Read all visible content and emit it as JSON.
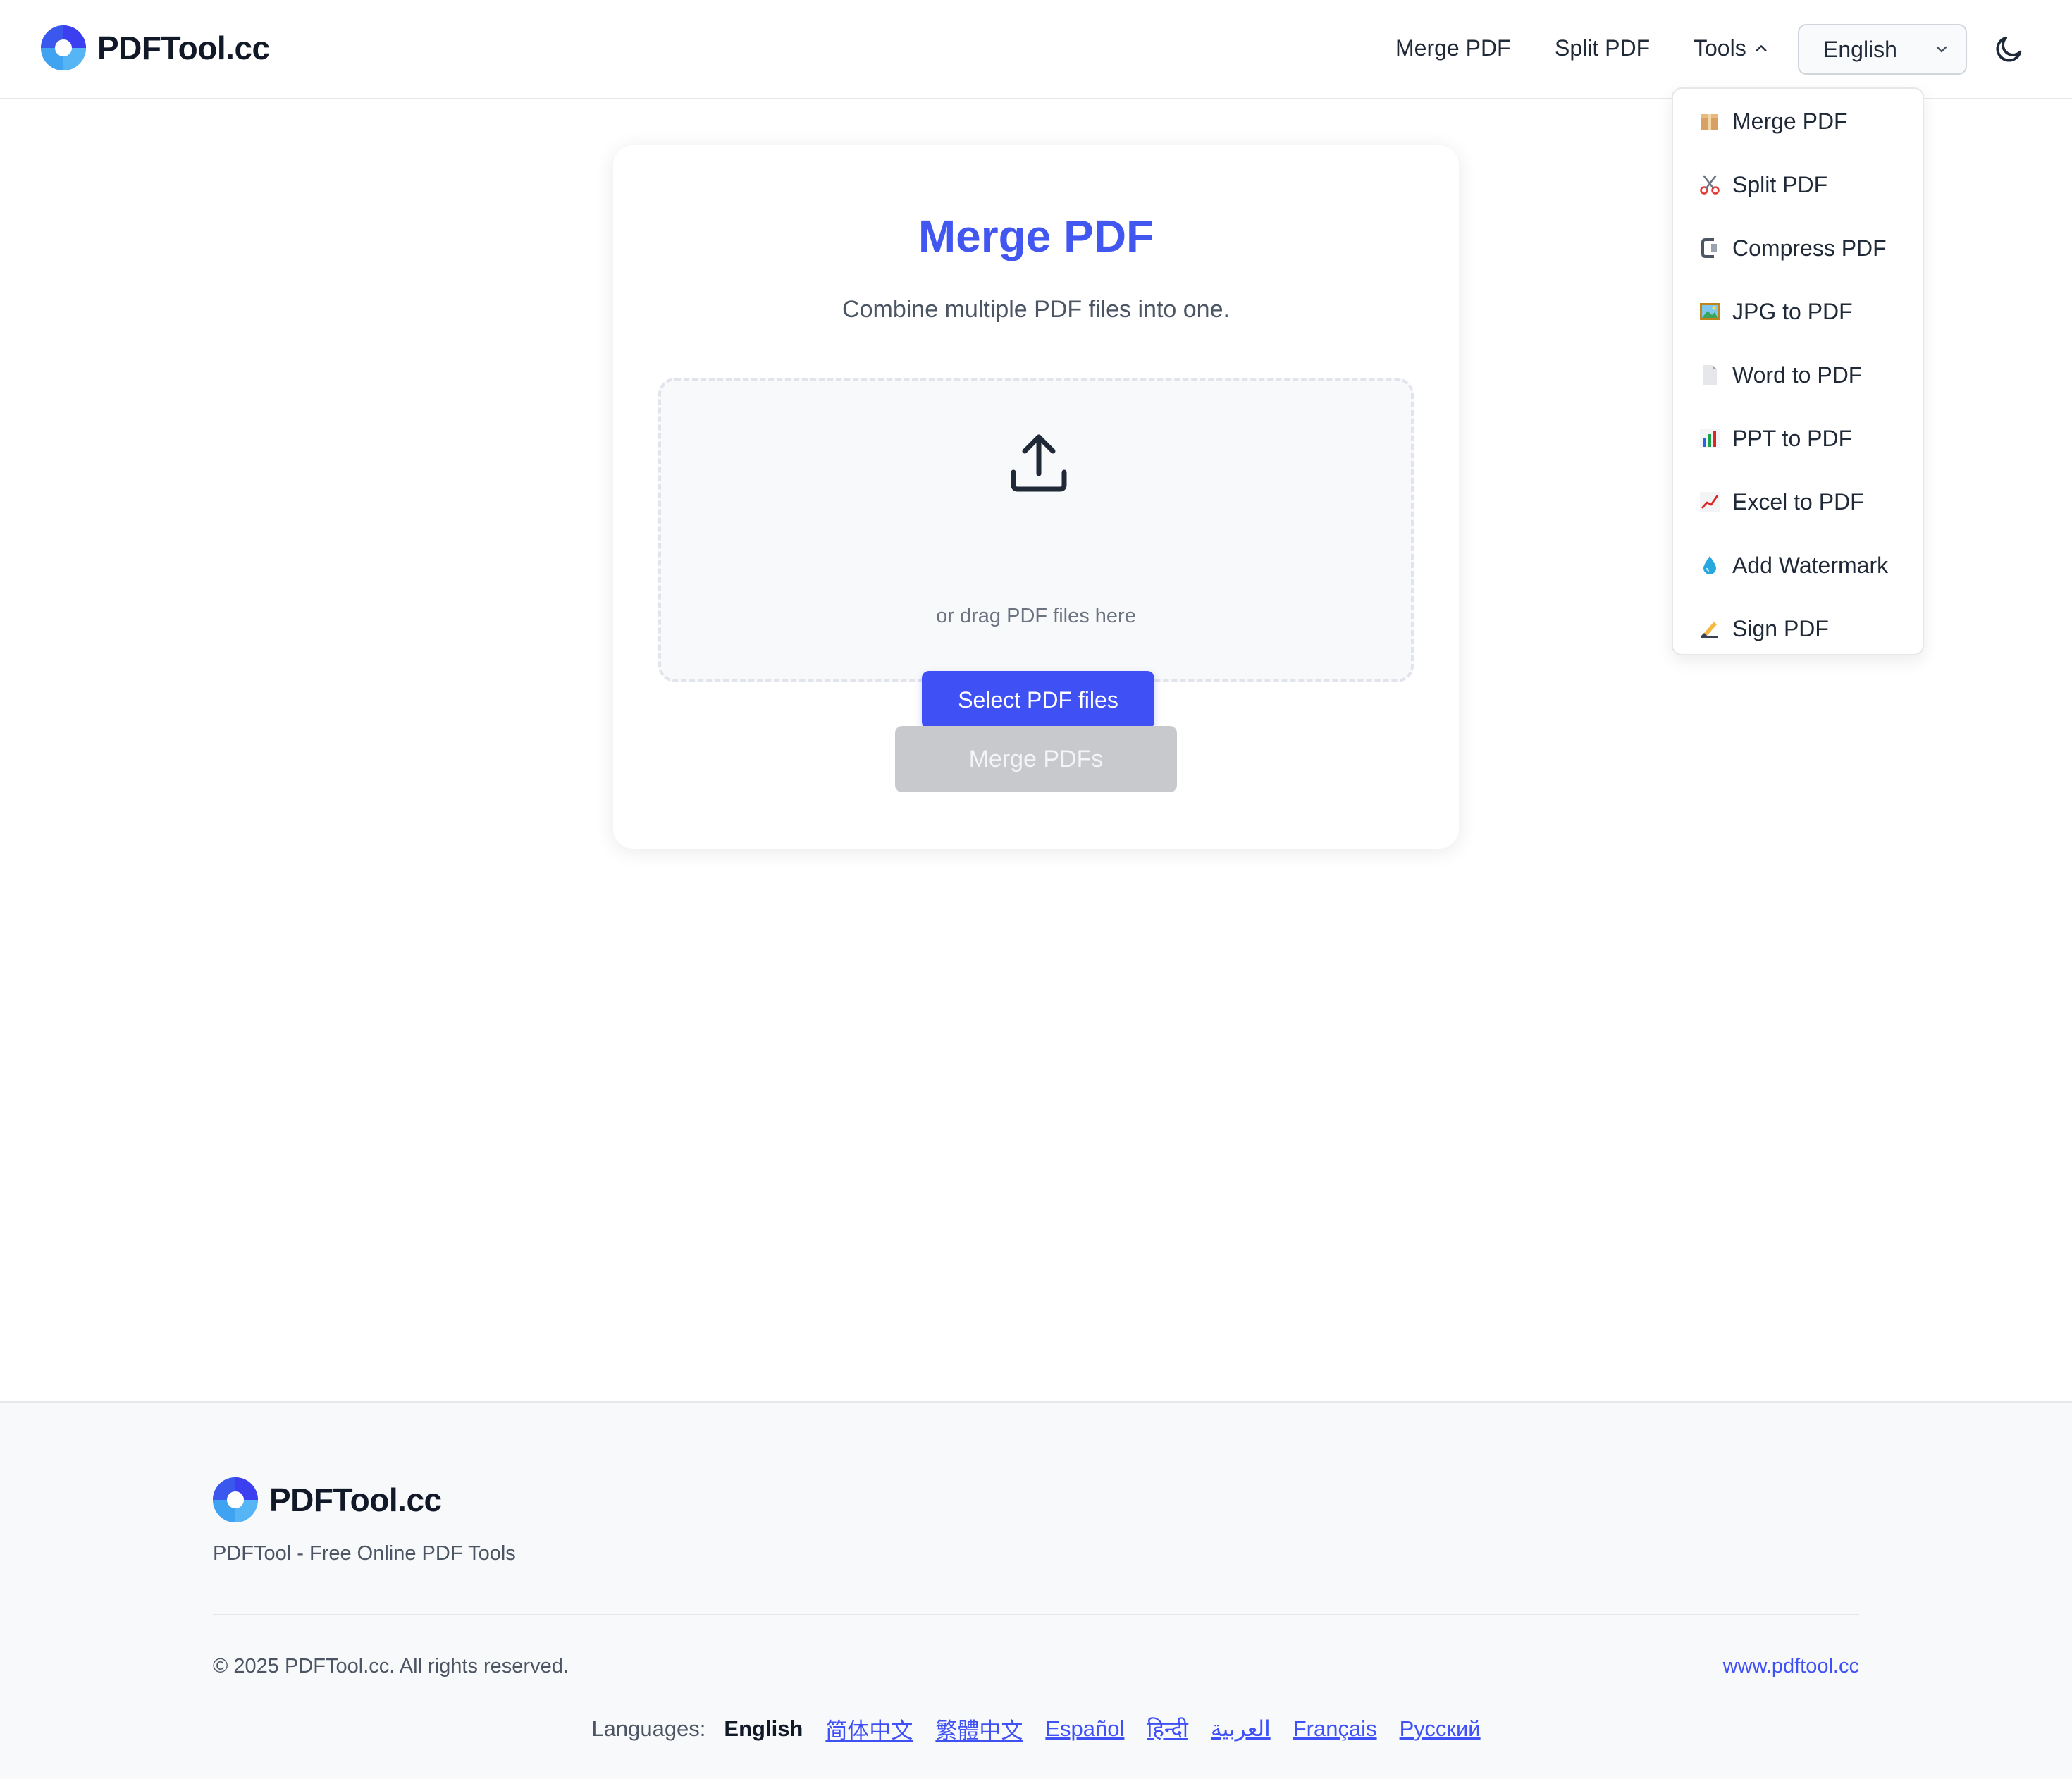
{
  "header": {
    "logo_text": "PDFTool.cc",
    "nav": {
      "merge": "Merge PDF",
      "split": "Split PDF",
      "tools": "Tools"
    },
    "language": "English"
  },
  "tools_menu": [
    {
      "label": "Merge PDF",
      "icon": "package-icon"
    },
    {
      "label": "Split PDF",
      "icon": "scissors-icon"
    },
    {
      "label": "Compress PDF",
      "icon": "clamp-icon"
    },
    {
      "label": "JPG to PDF",
      "icon": "picture-icon"
    },
    {
      "label": "Word to PDF",
      "icon": "page-icon"
    },
    {
      "label": "PPT to PDF",
      "icon": "bar-chart-icon"
    },
    {
      "label": "Excel to PDF",
      "icon": "line-chart-icon"
    },
    {
      "label": "Add Watermark",
      "icon": "droplet-icon"
    },
    {
      "label": "Sign PDF",
      "icon": "writing-hand-icon"
    }
  ],
  "card": {
    "title": "Merge PDF",
    "subtitle": "Combine multiple PDF files into one.",
    "select_button": "Select PDF files",
    "drag_hint": "or drag PDF files here",
    "merge_button": "Merge PDFs"
  },
  "footer": {
    "logo_text": "PDFTool.cc",
    "tagline": "PDFTool - Free Online PDF Tools",
    "copyright": "© 2025 PDFTool.cc. All rights reserved.",
    "site_link": "www.pdftool.cc",
    "languages_label": "Languages:",
    "current_language": "English",
    "languages": [
      "简体中文",
      "繁體中文",
      "Español",
      "हिन्दी",
      "العربية",
      "Français",
      "Русский"
    ]
  },
  "colors": {
    "accent": "#3f51f5",
    "title": "#4257f0",
    "disabled": "#c8c9cc"
  }
}
